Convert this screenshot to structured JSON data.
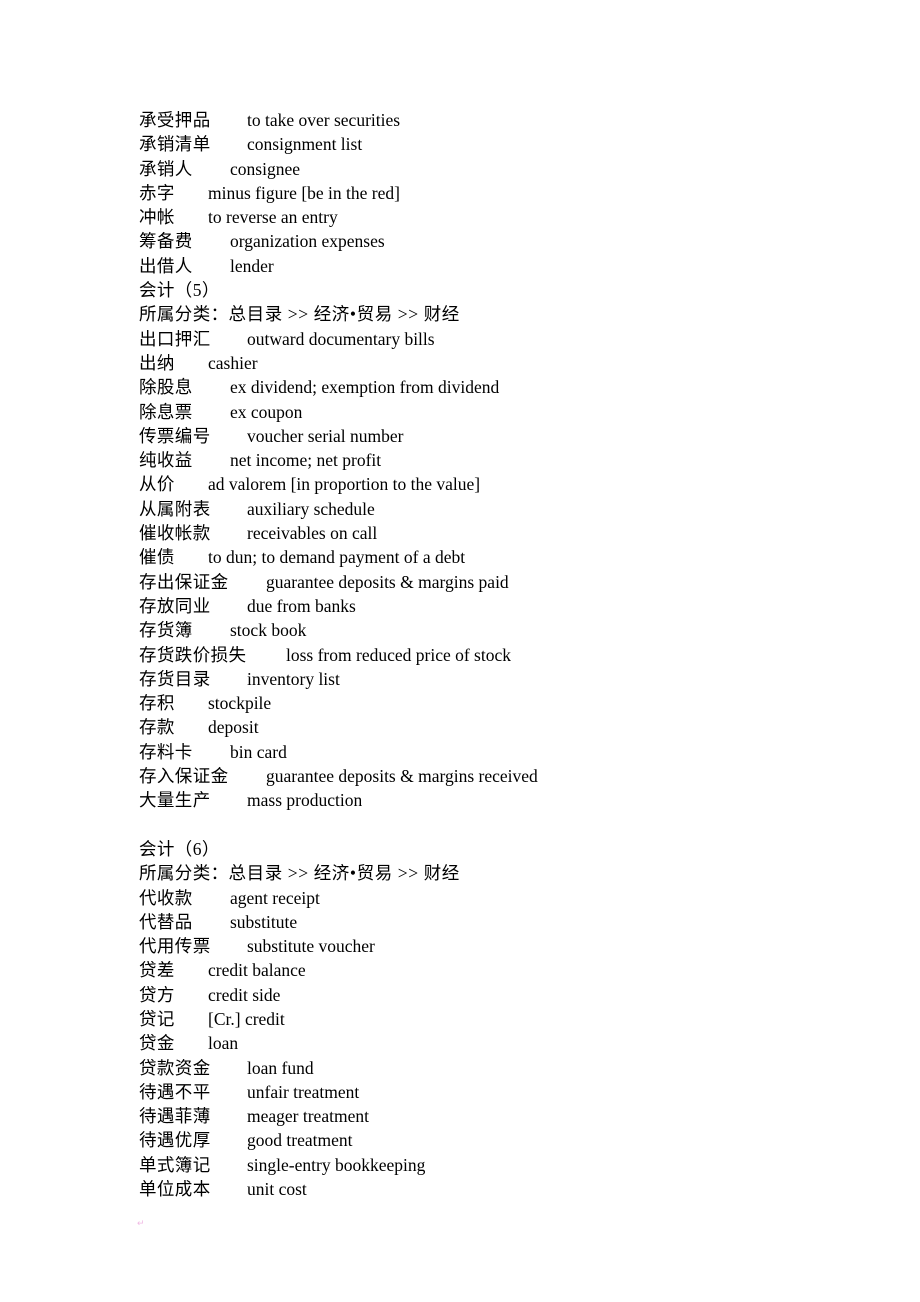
{
  "document": {
    "sections": [
      {
        "entries_before_heading": [
          {
            "term": "承受押品",
            "definition": "to take over securities"
          },
          {
            "term": "承销清单",
            "definition": "consignment list"
          },
          {
            "term": "承销人",
            "definition": "consignee"
          },
          {
            "term": "赤字",
            "definition": "minus figure [be in the red]"
          },
          {
            "term": "冲帐",
            "definition": "to reverse an entry"
          },
          {
            "term": "筹备费",
            "definition": "organization expenses"
          },
          {
            "term": "出借人",
            "definition": "lender"
          }
        ],
        "heading": "会计（5）",
        "category_label": "所属分类：",
        "category_path": "总目录 >> 经济•贸易 >> 财经",
        "entries": [
          {
            "term": "出口押汇",
            "definition": "outward documentary bills"
          },
          {
            "term": "出纳",
            "definition": "cashier"
          },
          {
            "term": "除股息",
            "definition": "ex dividend; exemption from dividend"
          },
          {
            "term": "除息票",
            "definition": "ex coupon"
          },
          {
            "term": "传票编号",
            "definition": "voucher serial number"
          },
          {
            "term": "纯收益",
            "definition": "net income; net profit"
          },
          {
            "term": "从价",
            "definition": "ad valorem [in proportion to the value]"
          },
          {
            "term": "从属附表",
            "definition": "auxiliary schedule"
          },
          {
            "term": "催收帐款",
            "definition": "receivables on call"
          },
          {
            "term": "催债",
            "definition": "to dun; to demand payment of a debt"
          },
          {
            "term": "存出保证金",
            "definition": "guarantee deposits & margins paid"
          },
          {
            "term": "存放同业",
            "definition": "due from banks"
          },
          {
            "term": "存货簿",
            "definition": "stock book"
          },
          {
            "term": "存货跌价损失",
            "definition": "loss from reduced price of stock"
          },
          {
            "term": "存货目录",
            "definition": "inventory list"
          },
          {
            "term": "存积",
            "definition": "stockpile"
          },
          {
            "term": "存款",
            "definition": "deposit"
          },
          {
            "term": "存料卡",
            "definition": "bin card"
          },
          {
            "term": "存入保证金",
            "definition": "guarantee deposits & margins received"
          },
          {
            "term": "大量生产",
            "definition": "mass production"
          }
        ]
      },
      {
        "heading": "会计（6）",
        "category_label": "所属分类：",
        "category_path": "总目录 >> 经济•贸易 >> 财经",
        "entries": [
          {
            "term": "代收款",
            "definition": "agent receipt"
          },
          {
            "term": "代替品",
            "definition": "substitute"
          },
          {
            "term": "代用传票",
            "definition": "substitute voucher"
          },
          {
            "term": "贷差",
            "definition": "credit balance"
          },
          {
            "term": "贷方",
            "definition": "credit side"
          },
          {
            "term": "贷记",
            "definition": "[Cr.] credit"
          },
          {
            "term": "贷金",
            "definition": "loan"
          },
          {
            "term": "贷款资金",
            "definition": "loan fund"
          },
          {
            "term": "待遇不平",
            "definition": "unfair treatment"
          },
          {
            "term": "待遇菲薄",
            "definition": "meager treatment"
          },
          {
            "term": "待遇优厚",
            "definition": "good treatment"
          },
          {
            "term": "单式簿记",
            "definition": "single-entry bookkeeping"
          },
          {
            "term": "单位成本",
            "definition": "unit cost"
          }
        ]
      }
    ],
    "stray_mark": "↵"
  }
}
